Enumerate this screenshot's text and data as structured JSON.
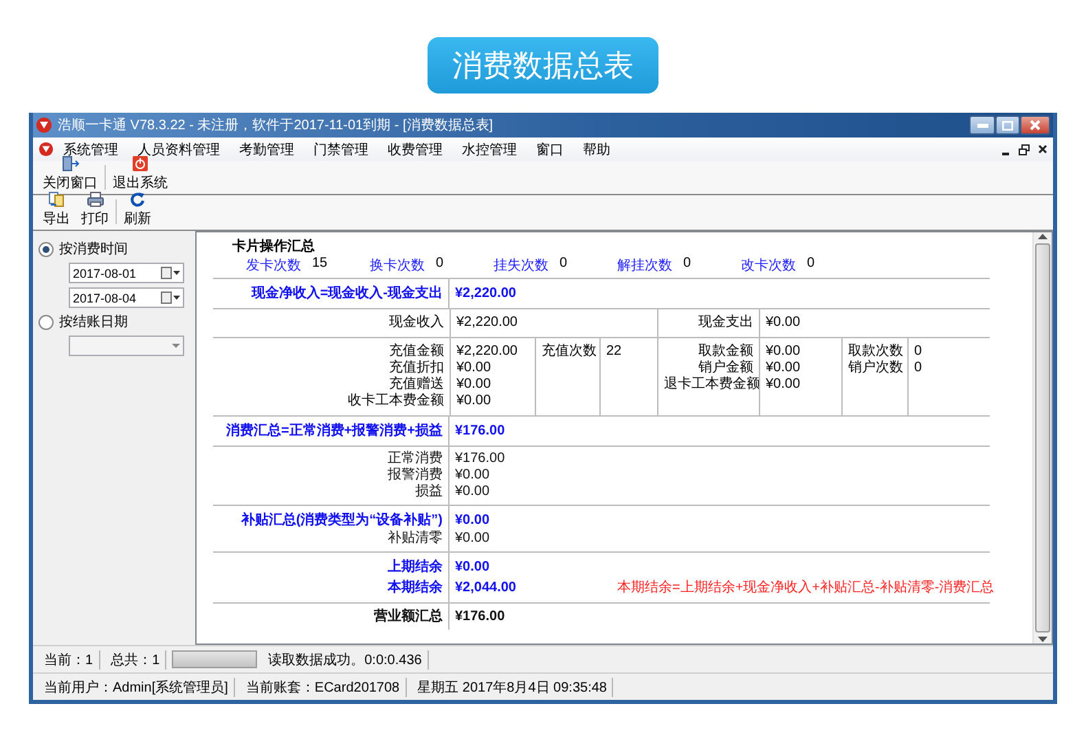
{
  "banner": {
    "title": "消费数据总表"
  },
  "window": {
    "title": "浩顺一卡通 V78.3.22 - 未注册，软件于2017-11-01到期 - [消费数据总表]"
  },
  "menu": [
    "系统管理",
    "人员资料管理",
    "考勤管理",
    "门禁管理",
    "收费管理",
    "水控管理",
    "窗口",
    "帮助"
  ],
  "main_toolbar": [
    {
      "kind": "close_window",
      "label": "关闭窗口"
    },
    {
      "kind": "exit",
      "label": "退出系统"
    }
  ],
  "report_toolbar": [
    {
      "kind": "export",
      "label": "导出"
    },
    {
      "kind": "print",
      "label": "打印"
    },
    {
      "kind": "refresh",
      "label": "刷新"
    }
  ],
  "filter": {
    "options": [
      {
        "label": "按消费时间",
        "selected": true
      },
      {
        "label": "按结账日期",
        "selected": false
      }
    ],
    "start_date": "2017-08-01",
    "end_date": "2017-08-04"
  },
  "report": {
    "title": "卡片操作汇总",
    "card_counts": [
      {
        "label": "发卡次数",
        "value": "15"
      },
      {
        "label": "换卡次数",
        "value": "0"
      },
      {
        "label": "挂失次数",
        "value": "0"
      },
      {
        "label": "解挂次数",
        "value": "0"
      },
      {
        "label": "改卡次数",
        "value": "0"
      }
    ],
    "blocks": [
      {
        "kind": "list",
        "lines": [
          {
            "kind": "formula",
            "label": "现金净收入=现金收入-现金支出",
            "value": "¥2,220.00"
          }
        ]
      },
      {
        "kind": "grid",
        "columns": [
          [
            "现金收入"
          ],
          [
            "¥2,220.00"
          ],
          [
            "现金支出"
          ],
          [
            "¥0.00"
          ]
        ]
      },
      {
        "kind": "grid",
        "columns": [
          [
            "充值金额",
            "充值折扣",
            "充值赠送",
            "收卡工本费金额"
          ],
          [
            "¥2,220.00",
            "¥0.00",
            "¥0.00",
            "¥0.00"
          ],
          [
            "充值次数"
          ],
          [
            "22"
          ],
          [
            "取款金额",
            "销户金额",
            "退卡工本费金额"
          ],
          [
            "¥0.00",
            "¥0.00",
            "¥0.00"
          ],
          [
            "取款次数",
            "销户次数"
          ],
          [
            "0",
            "0"
          ]
        ]
      },
      {
        "kind": "list",
        "lines": [
          {
            "kind": "formula",
            "label": "消费汇总=正常消费+报警消费+损益",
            "value": "¥176.00"
          }
        ]
      },
      {
        "kind": "list",
        "lines": [
          {
            "kind": "plain",
            "label": "正常消费",
            "value": "¥176.00"
          },
          {
            "kind": "plain",
            "label": "报警消费",
            "value": "¥0.00"
          },
          {
            "kind": "plain",
            "label": "损益",
            "value": "¥0.00"
          }
        ]
      },
      {
        "kind": "list",
        "lines": [
          {
            "kind": "formula",
            "label": "补贴汇总(消费类型为“设备补贴”)",
            "value": "¥0.00"
          },
          {
            "kind": "plain",
            "label": "补贴清零",
            "value": "¥0.00"
          }
        ]
      },
      {
        "kind": "list",
        "lines": [
          {
            "kind": "formula",
            "label": "上期结余",
            "value": "¥0.00"
          },
          {
            "kind": "formula",
            "label": "本期结余",
            "value": "¥2,044.00",
            "note": "本期结余=上期结余+现金净收入+补贴汇总-补贴清零-消费汇总"
          }
        ]
      },
      {
        "kind": "list",
        "lines": [
          {
            "kind": "total",
            "label": "营业额汇总",
            "value": "¥176.00"
          }
        ]
      }
    ]
  },
  "status_bar": {
    "current": "当前：1",
    "total": "总共：1",
    "progress": {
      "level": 1
    },
    "message": "读取数据成功。0:0:0.436"
  },
  "info_bar": [
    "当前用户：Admin[系统管理员]",
    "当前账套：ECard201708",
    "星期五  2017年8月4日 09:35:48"
  ]
}
